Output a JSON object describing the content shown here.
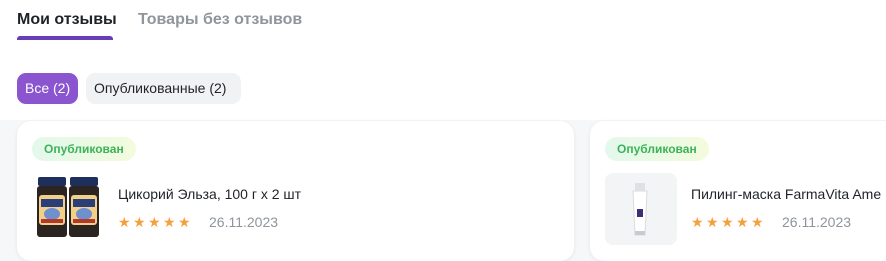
{
  "tabs": [
    {
      "label": "Мои отзывы",
      "active": true
    },
    {
      "label": "Товары без отзывов",
      "active": false
    }
  ],
  "filters": [
    {
      "label": "Все (2)",
      "active": true
    },
    {
      "label": "Опубликованные (2)",
      "active": false
    }
  ],
  "reviews": [
    {
      "status": "Опубликован",
      "product": "Цикорий Эльза, 100 г х 2 шт",
      "rating": 5,
      "date": "26.11.2023",
      "image": "chicory-jars-image"
    },
    {
      "status": "Опубликован",
      "product": "Пилинг-маска FarmaVita Ame",
      "rating": 5,
      "date": "26.11.2023",
      "image": "peeling-mask-tube-image"
    }
  ],
  "colors": {
    "accent": "#8a55cf",
    "tab_underline": "#6a3db8",
    "status_green": "#3cb35a",
    "star": "#f5a03b"
  }
}
